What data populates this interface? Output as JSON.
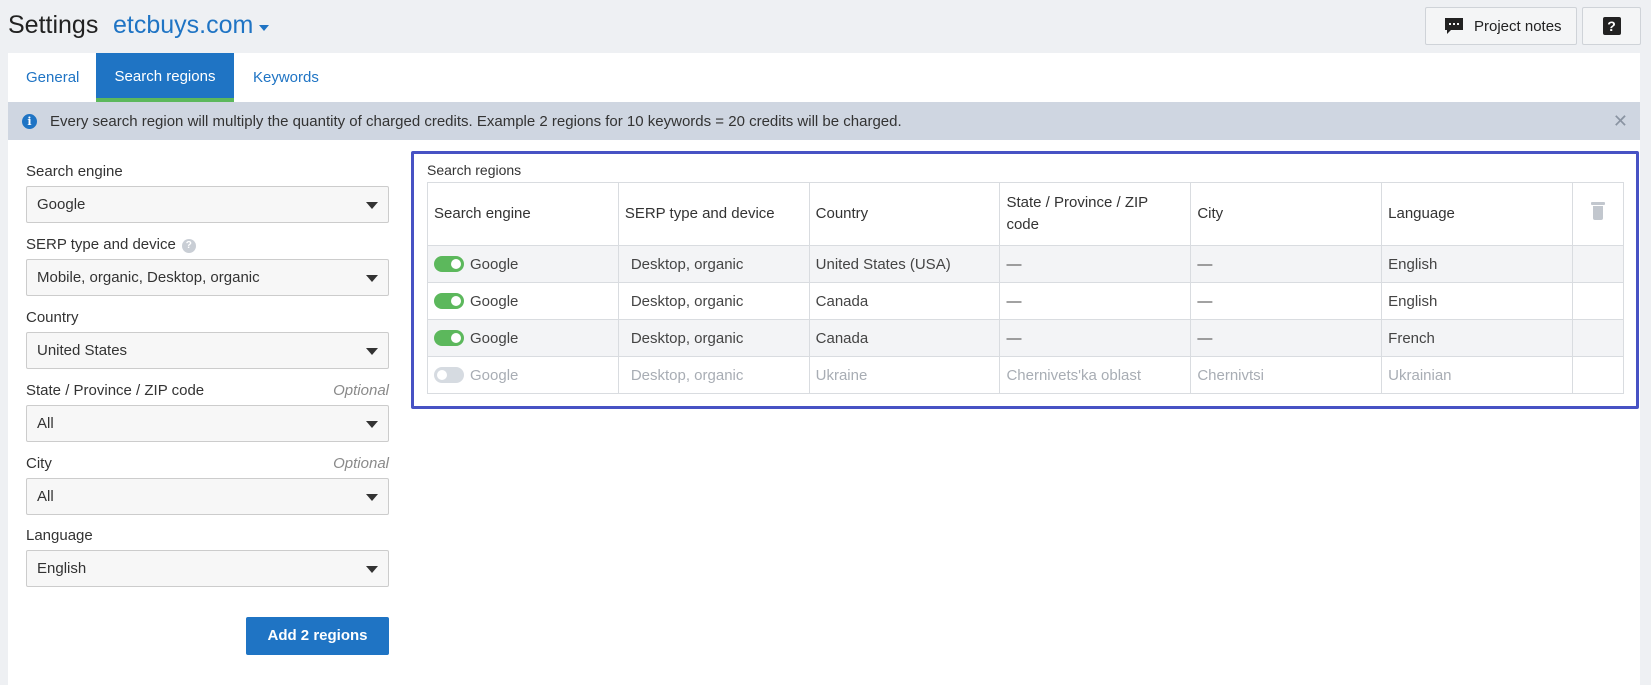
{
  "header": {
    "title": "Settings",
    "project": "etcbuys.com",
    "project_notes_label": "Project notes",
    "help_label": "?"
  },
  "tabs": [
    {
      "label": "General"
    },
    {
      "label": "Search regions",
      "active": true
    },
    {
      "label": "Keywords"
    }
  ],
  "notice": {
    "text": "Every search region will multiply the quantity of charged credits. Example 2 regions for 10 keywords = 20 credits will be charged.",
    "close": "✕"
  },
  "form": {
    "search_engine": {
      "label": "Search engine",
      "value": "Google"
    },
    "serp": {
      "label": "SERP type and device",
      "value": "Mobile, organic, Desktop, organic"
    },
    "country": {
      "label": "Country",
      "value": "United States"
    },
    "state": {
      "label": "State / Province / ZIP code",
      "optional": "Optional",
      "value": "All"
    },
    "city": {
      "label": "City",
      "optional": "Optional",
      "value": "All"
    },
    "language": {
      "label": "Language",
      "value": "English"
    },
    "add_button": "Add 2 regions"
  },
  "regions": {
    "title": "Search regions",
    "columns": [
      "Search engine",
      "SERP type and device",
      "Country",
      "State / Province / ZIP code",
      "City",
      "Language"
    ],
    "rows": [
      {
        "enabled": true,
        "engine": "Google",
        "serp": "Desktop, organic",
        "country": "United States (USA)",
        "state": "—",
        "city": "—",
        "language": "English"
      },
      {
        "enabled": true,
        "engine": "Google",
        "serp": "Desktop, organic",
        "country": "Canada",
        "state": "—",
        "city": "—",
        "language": "English"
      },
      {
        "enabled": true,
        "engine": "Google",
        "serp": "Desktop, organic",
        "country": "Canada",
        "state": "—",
        "city": "—",
        "language": "French"
      },
      {
        "enabled": false,
        "engine": "Google",
        "serp": "Desktop, organic",
        "country": "Ukraine",
        "state": "Chernivets'ka oblast",
        "city": "Chernivtsi",
        "language": "Ukrainian"
      }
    ]
  },
  "colors": {
    "accent": "#1f74c4",
    "toggle_on": "#5cb85c",
    "highlight_border": "#4752c4"
  },
  "icons": {
    "notes": "comment-icon",
    "info": "info-icon",
    "trash": "trash-icon"
  }
}
